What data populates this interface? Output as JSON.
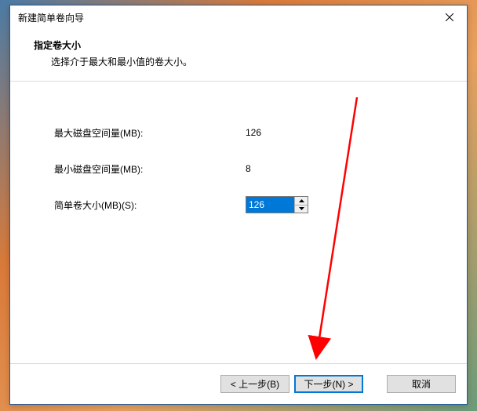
{
  "titlebar": {
    "title": "新建简单卷向导"
  },
  "header": {
    "title": "指定卷大小",
    "subtitle": "选择介于最大和最小值的卷大小。"
  },
  "fields": {
    "max_label": "最大磁盘空间量(MB):",
    "max_value": "126",
    "min_label": "最小磁盘空间量(MB):",
    "min_value": "8",
    "size_label": "简单卷大小(MB)(S):",
    "size_value": "126"
  },
  "buttons": {
    "back": "< 上一步(B)",
    "next": "下一步(N) >",
    "cancel": "取消"
  }
}
